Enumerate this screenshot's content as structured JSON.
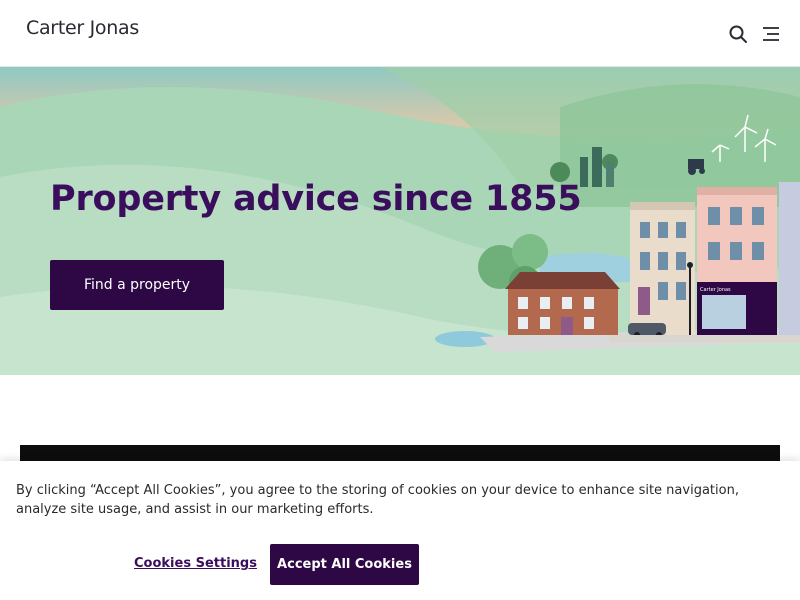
{
  "header": {
    "logo_text": "Carter Jonas",
    "icons": [
      "search-icon",
      "menu-icon"
    ]
  },
  "hero": {
    "title": "Property advice since 1855",
    "cta_label": "Find a property",
    "shop_sign": "Carter Jonas"
  },
  "cookie_banner": {
    "text": "By clicking “Accept All Cookies”, you agree to the storing of cookies on your device to enhance site navigation, analyze site usage, and assist in our marketing efforts.",
    "settings_label": "Cookies Settings",
    "accept_label": "Accept All Cookies"
  },
  "colors": {
    "brand_purple": "#2d0845",
    "title_purple": "#3a0e5c",
    "hero_green": "#a8d5b8",
    "dark_band": "#0d0d0d"
  }
}
